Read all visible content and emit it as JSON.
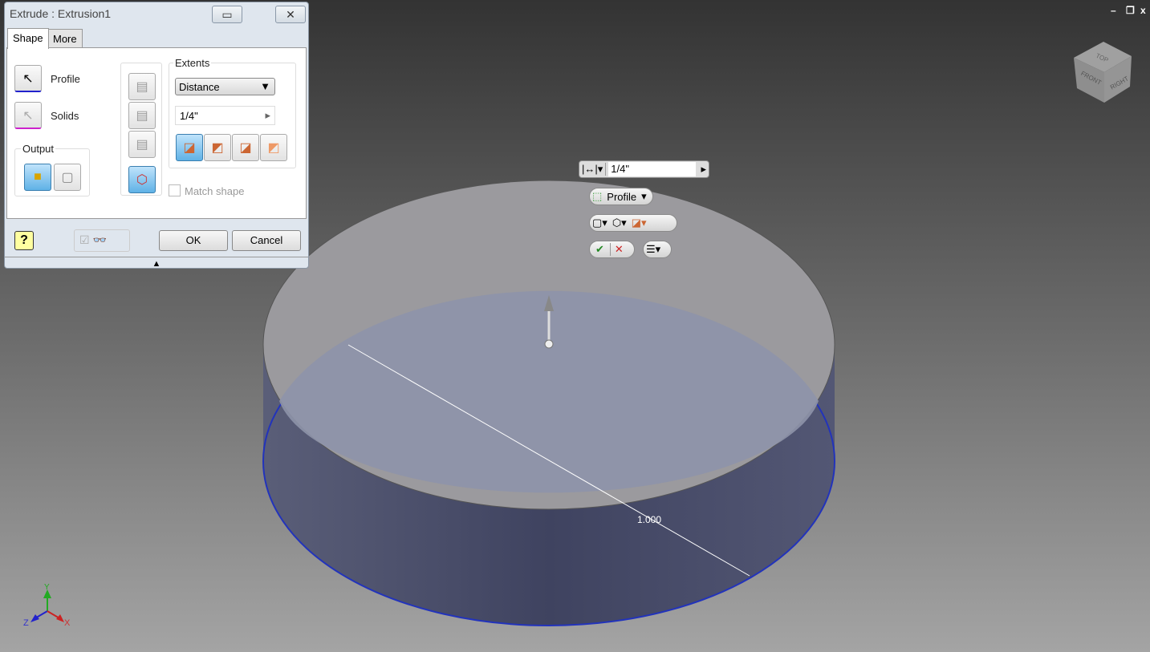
{
  "dialog": {
    "title": "Extrude : Extrusion1",
    "tabs": [
      {
        "label": "Shape"
      },
      {
        "label": "More"
      }
    ],
    "profile_label": "Profile",
    "solids_label": "Solids",
    "output_label": "Output",
    "extents_label": "Extents",
    "extents_value": "Distance",
    "distance_value": "1/4\"",
    "match_shape_label": "Match shape",
    "ok_label": "OK",
    "cancel_label": "Cancel"
  },
  "minitoolbar": {
    "distance_value": "1/4\"",
    "profile_label": "Profile"
  },
  "viewcube": {
    "top": "TOP",
    "front": "FRONT",
    "right": "RIGHT"
  },
  "dimension": {
    "value": "1.000"
  },
  "triad": {
    "x": "X",
    "y": "Y",
    "z": "Z"
  },
  "colors": {
    "x_axis": "#d02020",
    "y_axis": "#20a020",
    "z_axis": "#2030d0",
    "accent": "#5fb2e6"
  }
}
